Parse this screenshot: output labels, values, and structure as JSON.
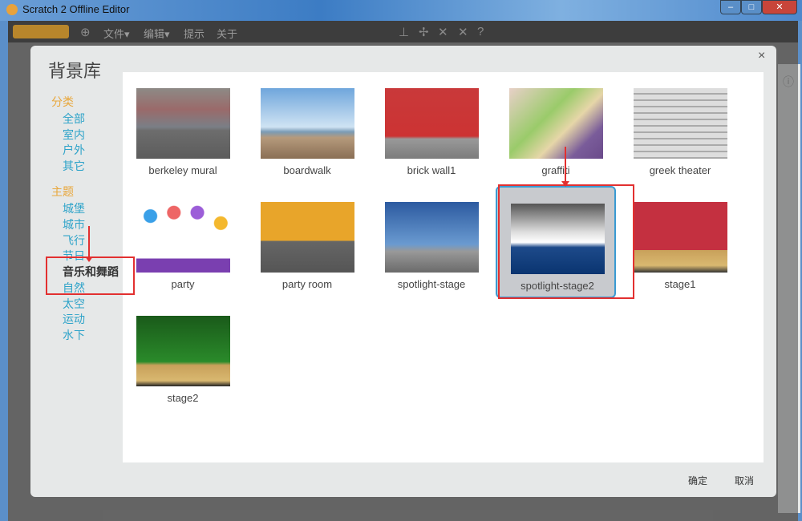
{
  "window": {
    "title": "Scratch 2 Offline Editor"
  },
  "menubar": {
    "logo": "SCRATCH",
    "items": [
      "文件▾",
      "编辑▾",
      "提示",
      "关于"
    ]
  },
  "dialog": {
    "title": "背景库",
    "close": "×",
    "category_header": "分类",
    "categories": [
      "全部",
      "室内",
      "户外",
      "其它"
    ],
    "theme_header": "主题",
    "themes": [
      "城堡",
      "城市",
      "飞行",
      "节日",
      "音乐和舞蹈",
      "自然",
      "太空",
      "运动",
      "水下"
    ],
    "selected_theme": "音乐和舞蹈",
    "items": [
      {
        "label": "berkeley mural"
      },
      {
        "label": "boardwalk"
      },
      {
        "label": "brick wall1"
      },
      {
        "label": "graffiti"
      },
      {
        "label": "greek theater"
      },
      {
        "label": "party"
      },
      {
        "label": "party room"
      },
      {
        "label": "spotlight-stage"
      },
      {
        "label": "spotlight-stage2",
        "selected": true
      },
      {
        "label": "stage1"
      },
      {
        "label": "stage2"
      }
    ],
    "ok": "确定",
    "cancel": "取消"
  },
  "colors": {
    "category_header": "#e8a73c",
    "category_link": "#2ea3c9",
    "highlight": "#e23030",
    "selection": "#3a9ad2"
  }
}
